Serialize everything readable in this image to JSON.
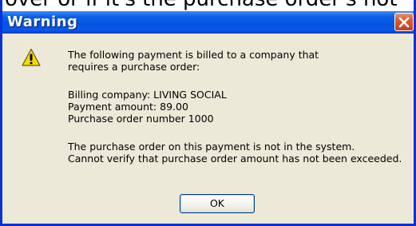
{
  "background": {
    "partial_text": "over or if it's the purchase order's not"
  },
  "window": {
    "title": "Warning"
  },
  "icons": {
    "close": "close-icon",
    "warning": "warning-icon"
  },
  "message": {
    "line1": "The following payment is billed to a company that",
    "line2": "requires a purchase order:",
    "billing_company": "Billing company:  LIVING SOCIAL",
    "payment_amount": "Payment amount:      89.00",
    "po_number": "Purchase order number  1000",
    "note1": "The purchase order on this payment is not in the system.",
    "note2": "Cannot verify that purchase order amount has not been exceeded."
  },
  "buttons": {
    "ok": "OK"
  },
  "colors": {
    "titlebar": "#0553e0",
    "close": "#d85a2c",
    "dialog_bg": "#ece9d8"
  }
}
